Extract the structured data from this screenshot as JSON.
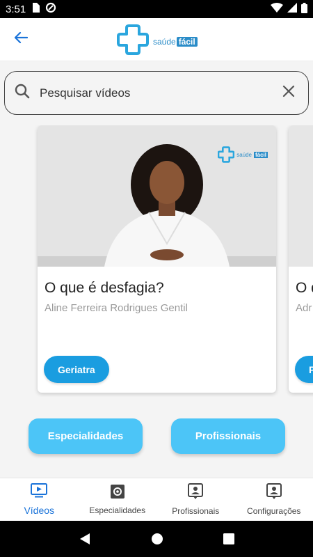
{
  "status_bar": {
    "time": "3:51"
  },
  "app_bar": {
    "logo_word": "saúde",
    "logo_highlight": "fácil"
  },
  "search": {
    "placeholder": "Pesquisar vídeos",
    "value": ""
  },
  "videos": [
    {
      "title": "O que é desfagia?",
      "author": "Aline Ferreira Rodrigues Gentil",
      "tag": "Geriatra",
      "watermark_word": "saúde",
      "watermark_highlight": "fácil"
    },
    {
      "title": "O q",
      "author": "Adr",
      "tag": "P"
    }
  ],
  "actions": {
    "specialties": "Especialidades",
    "professionals": "Profissionais"
  },
  "bottom_nav": [
    {
      "label": "Vídeos",
      "icon": "video-icon",
      "active": true
    },
    {
      "label": "Especialidades",
      "icon": "specialty-icon",
      "active": false
    },
    {
      "label": "Profissionais",
      "icon": "professional-icon",
      "active": false
    },
    {
      "label": "Configurações",
      "icon": "settings-icon",
      "active": false
    }
  ],
  "colors": {
    "accent": "#1a73d9",
    "chip": "#1a9de0",
    "action_button": "#4cc5f7",
    "brand": "#2a8cc8"
  }
}
